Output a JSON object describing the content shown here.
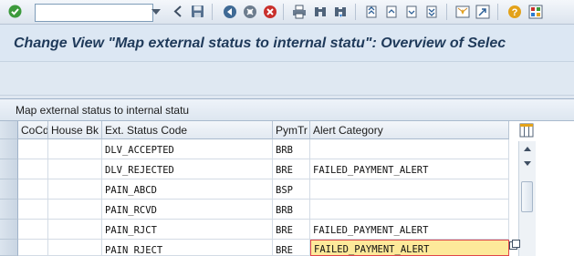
{
  "toolbar": {
    "command_field_value": "",
    "icons": [
      "enter-icon",
      "command-dropdown-icon",
      "back-nav-icon",
      "save-icon",
      "back-icon",
      "exit-icon",
      "cancel-icon",
      "print-icon",
      "find-icon",
      "find-next-icon",
      "first-page-icon",
      "previous-page-icon",
      "next-page-icon",
      "last-page-icon",
      "create-session-icon",
      "create-shortcut-icon",
      "help-icon",
      "customize-layout-icon"
    ]
  },
  "title": "Change View \"Map external status to internal statu\": Overview of Selec",
  "table": {
    "caption": "Map external status to internal statu",
    "columns": [
      "CoCd",
      "House Bk",
      "Ext. Status Code",
      "PymTr",
      "Alert Category"
    ],
    "rows": [
      {
        "cocd": "",
        "house_bk": "",
        "ext_status": "DLV_ACCEPTED",
        "pymtr": "BRB",
        "alert": ""
      },
      {
        "cocd": "",
        "house_bk": "",
        "ext_status": "DLV_REJECTED",
        "pymtr": "BRE",
        "alert": "FAILED_PAYMENT_ALERT"
      },
      {
        "cocd": "",
        "house_bk": "",
        "ext_status": "PAIN_ABCD",
        "pymtr": "BSP",
        "alert": ""
      },
      {
        "cocd": "",
        "house_bk": "",
        "ext_status": "PAIN_RCVD",
        "pymtr": "BRB",
        "alert": ""
      },
      {
        "cocd": "",
        "house_bk": "",
        "ext_status": "PAIN_RJCT",
        "pymtr": "BRE",
        "alert": "FAILED_PAYMENT_ALERT"
      },
      {
        "cocd": "",
        "house_bk": "",
        "ext_status": "PAIN_RJECT",
        "pymtr": "BRE",
        "alert": "FAILED_PAYMENT_ALERT"
      }
    ],
    "focused_cell": "rows.5.alert"
  },
  "colors": {
    "accent": "#1f3a5a",
    "focus_fill": "#fde99a",
    "focus_border": "#e0454b"
  }
}
